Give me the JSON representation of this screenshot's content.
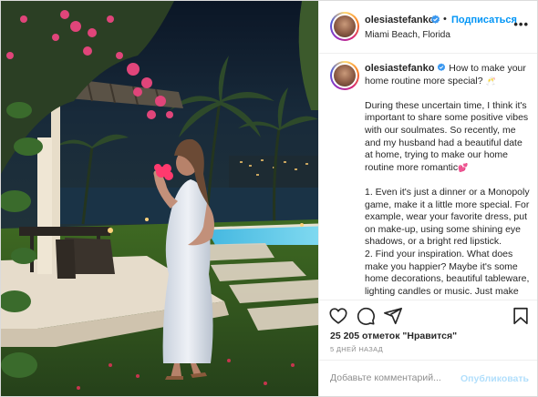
{
  "post": {
    "username": "olesiastefanko",
    "verified_icon": "verified-badge-icon",
    "separator": "•",
    "follow_label": "Подписаться",
    "location": "Miami Beach, Florida",
    "more_icon": "more-options-icon",
    "more_label": "•••",
    "caption": {
      "username": "olesiastefanko",
      "intro": "How to make your home routine more special?",
      "intro_emoji": "🥂",
      "para1": "During these uncertain time, I think it's important to share some positive vibes with our soulmates. So recently, me and my husband had a beautiful date at home, trying to make our home routine more romantic",
      "para1_emoji": "💕",
      "point1": "1. Even it's just a dinner or a Monopoly game, make it a little more special. For example, wear your favorite dress, put on make-up, using some shining eye shadows, or a bright red lipstick.",
      "point2": "2. Find your inspiration. What does make you happier? Maybe it's some home decorations, beautiful tableware, lighting candles or music. Just make"
    },
    "actions": {
      "like_icon": "heart-icon",
      "comment_icon": "comment-icon",
      "share_icon": "share-icon",
      "save_icon": "bookmark-icon"
    },
    "likes": "25 205 отметок \"Нравится\"",
    "time_ago": "5 ДНЕЙ НАЗАД",
    "comment": {
      "placeholder": "Добавьте комментарий...",
      "publish_label": "Опубликовать"
    }
  },
  "colors": {
    "link_blue": "#0095f6",
    "publish_disabled": "#b2dffc",
    "text": "#262626",
    "muted": "#8e8e8e",
    "divider": "#efefef"
  }
}
